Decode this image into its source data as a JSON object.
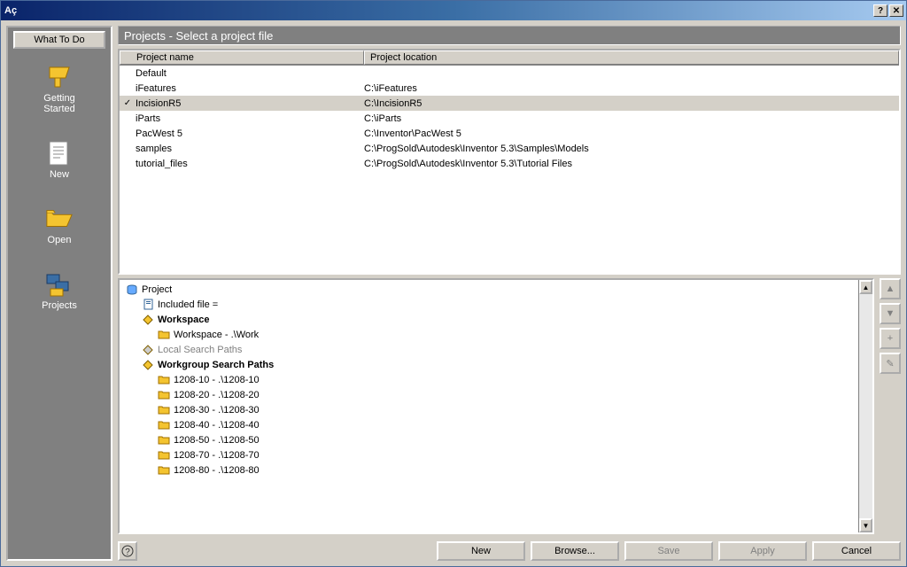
{
  "window_title": "Aç",
  "sidebar": {
    "what_to_do": "What To Do",
    "items": [
      {
        "label": "Getting\nStarted"
      },
      {
        "label": "New"
      },
      {
        "label": "Open"
      },
      {
        "label": "Projects"
      }
    ]
  },
  "header": "Projects - Select a project file",
  "table": {
    "headers": {
      "name": "Project name",
      "location": "Project location"
    },
    "rows": [
      {
        "name": "Default",
        "location": "",
        "active": false
      },
      {
        "name": "iFeatures",
        "location": "C:\\iFeatures",
        "active": false
      },
      {
        "name": "IncisionR5",
        "location": "C:\\IncisionR5",
        "active": true
      },
      {
        "name": "iParts",
        "location": "C:\\iParts",
        "active": false
      },
      {
        "name": "PacWest 5",
        "location": "C:\\Inventor\\PacWest 5",
        "active": false
      },
      {
        "name": "samples",
        "location": "C:\\ProgSold\\Autodesk\\Inventor 5.3\\Samples\\Models",
        "active": false
      },
      {
        "name": "tutorial_files",
        "location": "C:\\ProgSold\\Autodesk\\Inventor 5.3\\Tutorial Files",
        "active": false
      }
    ]
  },
  "tree": {
    "root": "Project",
    "included_file": "Included file =",
    "workspace": "Workspace",
    "workspace_child": "Workspace - .\\Work",
    "local_search": "Local Search Paths",
    "workgroup_search": "Workgroup Search Paths",
    "workgroup_children": [
      "1208-10 - .\\1208-10",
      "1208-20 - .\\1208-20",
      "1208-30 - .\\1208-30",
      "1208-40 - .\\1208-40",
      "1208-50 - .\\1208-50",
      "1208-70 - .\\1208-70",
      "1208-80 - .\\1208-80"
    ]
  },
  "right_buttons": {
    "up": "▲",
    "down": "▼",
    "add": "+",
    "edit": "✎"
  },
  "bottom": {
    "new": "New",
    "browse": "Browse...",
    "save": "Save",
    "apply": "Apply",
    "cancel": "Cancel"
  }
}
